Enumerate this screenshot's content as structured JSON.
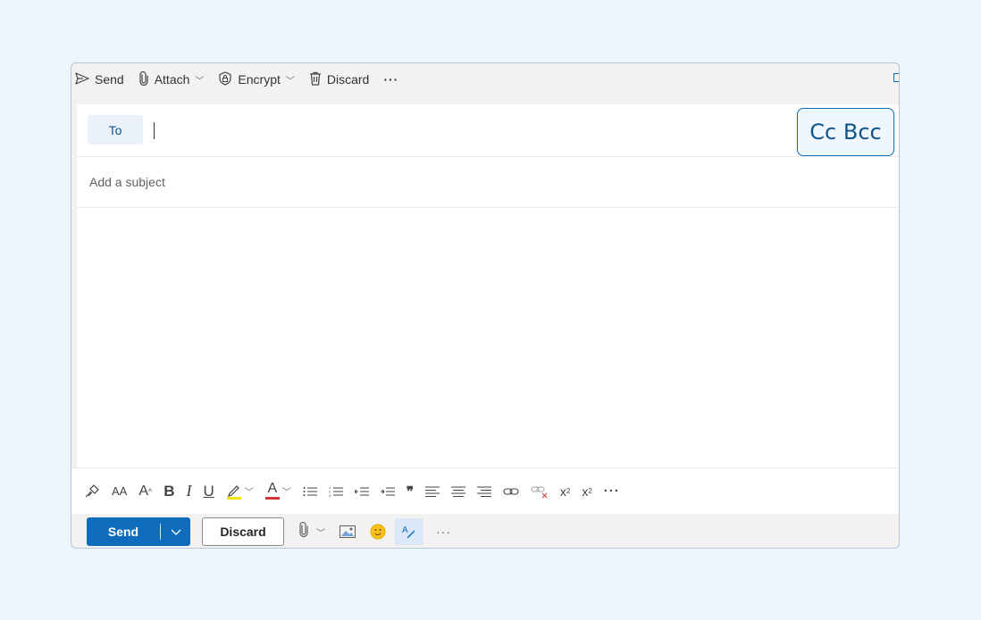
{
  "topbar": {
    "send_label": "Send",
    "attach_label": "Attach",
    "encrypt_label": "Encrypt",
    "discard_label": "Discard",
    "more_label": "···"
  },
  "compose": {
    "to_label": "To",
    "to_value": "",
    "ccbcc_label": "Cc Bcc",
    "subject_placeholder": "Add a subject",
    "subject_value": ""
  },
  "format_toolbar": {
    "font_size_label": "AA",
    "grow_font_label": "A",
    "bold_label": "B",
    "italic_label": "I",
    "underline_label": "U",
    "font_color_label": "A",
    "quote_label": "❞",
    "superscript_label": "x",
    "subscript_label": "x",
    "more_label": "···",
    "highlight_color": "#f4e20b",
    "font_color": "#d13438"
  },
  "bottom_bar": {
    "send_label": "Send",
    "discard_label": "Discard",
    "more_label": "···"
  },
  "colors": {
    "accent": "#0f6cbd",
    "background": "#eef4fc"
  }
}
